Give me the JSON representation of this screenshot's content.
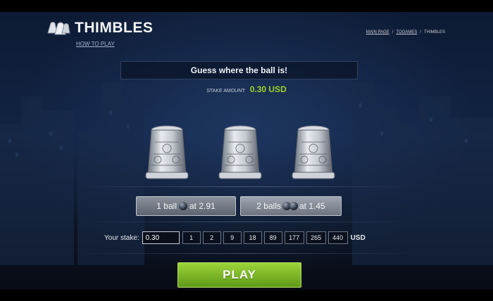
{
  "app": {
    "title": "THIMBLES",
    "logo_icon": "thimbles-logo-icon",
    "how_to_play": "HOW TO PLAY"
  },
  "breadcrumb": {
    "items": [
      "MAIN PAGE",
      "TOGAMES",
      "THIMBLES"
    ],
    "separator": "/"
  },
  "game": {
    "prompt": "Guess where the ball is!",
    "stake_amount_label": "STAKE AMOUNT:",
    "stake_amount_value": "0.30 USD",
    "thimbles": [
      "thimble-left",
      "thimble-center",
      "thimble-right"
    ]
  },
  "bet_options": {
    "one_ball_label": "1 ball",
    "one_ball_odds": "at 2.91",
    "two_balls_label": "2 balls",
    "two_balls_odds": "at 1.45"
  },
  "stake": {
    "label": "Your stake:",
    "value": "0.30",
    "chips": [
      "1",
      "2",
      "9",
      "18",
      "89",
      "177",
      "265",
      "440"
    ],
    "currency": "USD"
  },
  "play_label": "PLAY",
  "colors": {
    "accent_green": "#9ed12a",
    "play_button": "#7bb52a",
    "background": "#0d1a33"
  }
}
